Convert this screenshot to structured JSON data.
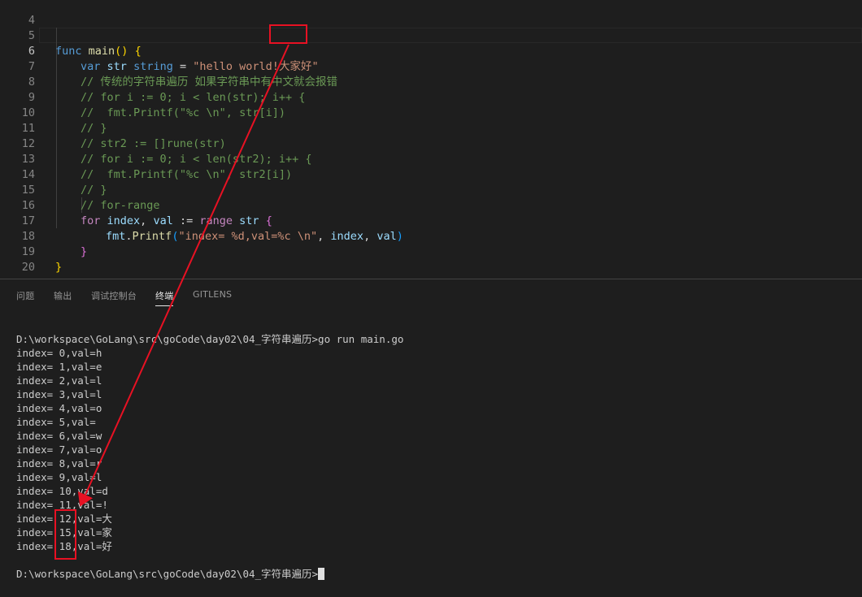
{
  "editor": {
    "line_numbers": [
      "4",
      "5",
      "6",
      "7",
      "8",
      "9",
      "10",
      "11",
      "12",
      "13",
      "14",
      "15",
      "16",
      "17",
      "18",
      "19",
      "20"
    ],
    "line5": {
      "kw": "func",
      "fn": "main",
      "paren": "()",
      "brace": "{"
    },
    "line6": {
      "kw": "var",
      "var": "str",
      "type": "string",
      "eq": "=",
      "str_a": "\"hello world!",
      "str_b": "大家好",
      "str_c": "\""
    },
    "line7": "// 传统的字符串遍历 如果字符串中有中文就会报错",
    "line8": "// for i := 0; i < len(str); i++ {",
    "line9": "//  fmt.Printf(\"%c \\n\", str[i])",
    "line10": "// }",
    "line11": "// str2 := []rune(str)",
    "line12": "// for i := 0; i < len(str2); i++ {",
    "line13": "//  fmt.Printf(\"%c \\n\", str2[i])",
    "line14": "// }",
    "line15": "// for-range",
    "line16": {
      "kw": "for",
      "v1": "index",
      "comma": ",",
      "v2": "val",
      "op": ":=",
      "range": "range",
      "v3": "str",
      "brace": "{"
    },
    "line17": {
      "pkg": "fmt",
      "dot": ".",
      "fn": "Printf",
      "open": "(",
      "str": "\"index= %d,val=%c \\n\"",
      "comma1": ",",
      "a1": "index",
      "comma2": ",",
      "a2": "val",
      "close": ")"
    },
    "line18": "}",
    "line19": "}"
  },
  "panel": {
    "tabs": [
      "问题",
      "输出",
      "调试控制台",
      "终端",
      "GITLENS"
    ],
    "active_tab": "终端"
  },
  "terminal": {
    "command_line": "D:\\workspace\\GoLang\\src\\goCode\\day02\\04_字符串遍历>go run main.go",
    "output": [
      "index= 0,val=h",
      "index= 1,val=e",
      "index= 2,val=l",
      "index= 3,val=l",
      "index= 4,val=o",
      "index= 5,val= ",
      "index= 6,val=w",
      "index= 7,val=o",
      "index= 8,val=r",
      "index= 9,val=l",
      "index= 10,val=d",
      "index= 11,val=!",
      "index= 12,val=大",
      "index= 15,val=家",
      "index= 18,val=好"
    ],
    "prompt": "D:\\workspace\\GoLang\\src\\goCode\\day02\\04_字符串遍历>"
  },
  "annotation": {
    "color": "#e81123"
  }
}
